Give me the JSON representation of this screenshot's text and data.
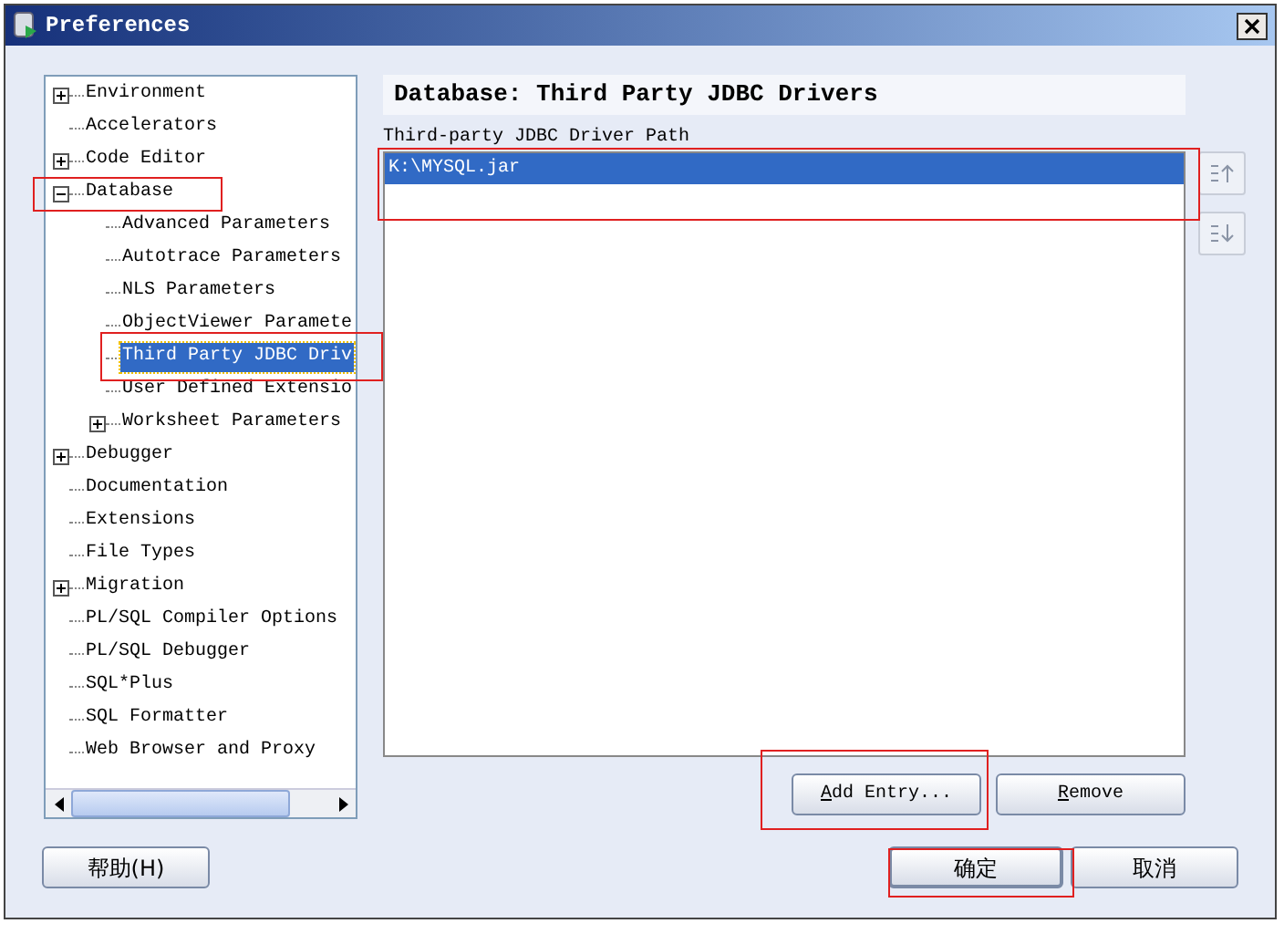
{
  "window": {
    "title": "Preferences"
  },
  "tree": [
    {
      "label": "Environment",
      "kind": "group",
      "expanded": false,
      "selected": false
    },
    {
      "label": "Accelerators",
      "kind": "leaf",
      "selected": false
    },
    {
      "label": "Code Editor",
      "kind": "group",
      "expanded": false,
      "selected": false
    },
    {
      "label": "Database",
      "kind": "group",
      "expanded": true,
      "selected": false,
      "children": [
        {
          "label": "Advanced Parameters",
          "kind": "leaf",
          "selected": false
        },
        {
          "label": "Autotrace Parameters",
          "kind": "leaf",
          "selected": false
        },
        {
          "label": "NLS Parameters",
          "kind": "leaf",
          "selected": false
        },
        {
          "label": "ObjectViewer Paramete",
          "kind": "leaf",
          "selected": false
        },
        {
          "label": "Third Party JDBC Driv",
          "kind": "leaf",
          "selected": true
        },
        {
          "label": "User Defined Extensio",
          "kind": "leaf",
          "selected": false
        },
        {
          "label": "Worksheet Parameters",
          "kind": "group",
          "expanded": false,
          "selected": false
        }
      ]
    },
    {
      "label": "Debugger",
      "kind": "group",
      "expanded": false,
      "selected": false
    },
    {
      "label": "Documentation",
      "kind": "leaf",
      "selected": false
    },
    {
      "label": "Extensions",
      "kind": "leaf",
      "selected": false
    },
    {
      "label": "File Types",
      "kind": "leaf",
      "selected": false
    },
    {
      "label": "Migration",
      "kind": "group",
      "expanded": false,
      "selected": false
    },
    {
      "label": "PL/SQL Compiler Options",
      "kind": "leaf",
      "selected": false
    },
    {
      "label": "PL/SQL Debugger",
      "kind": "leaf",
      "selected": false
    },
    {
      "label": "SQL*Plus",
      "kind": "leaf",
      "selected": false
    },
    {
      "label": "SQL Formatter",
      "kind": "leaf",
      "selected": false
    },
    {
      "label": "Web Browser and Proxy",
      "kind": "leaf",
      "selected": false
    }
  ],
  "page": {
    "title": "Database: Third Party JDBC Drivers",
    "list_label": "Third-party JDBC Driver Path",
    "entries": [
      {
        "text": "K:\\MYSQL.jar",
        "selected": true
      }
    ],
    "buttons": [
      {
        "mnemonic": "A",
        "rest": "dd Entry..."
      },
      {
        "mnemonic": "R",
        "rest": "emove"
      }
    ]
  },
  "footer": {
    "help": "帮助(H)",
    "ok": "确定",
    "cancel": "取消"
  }
}
